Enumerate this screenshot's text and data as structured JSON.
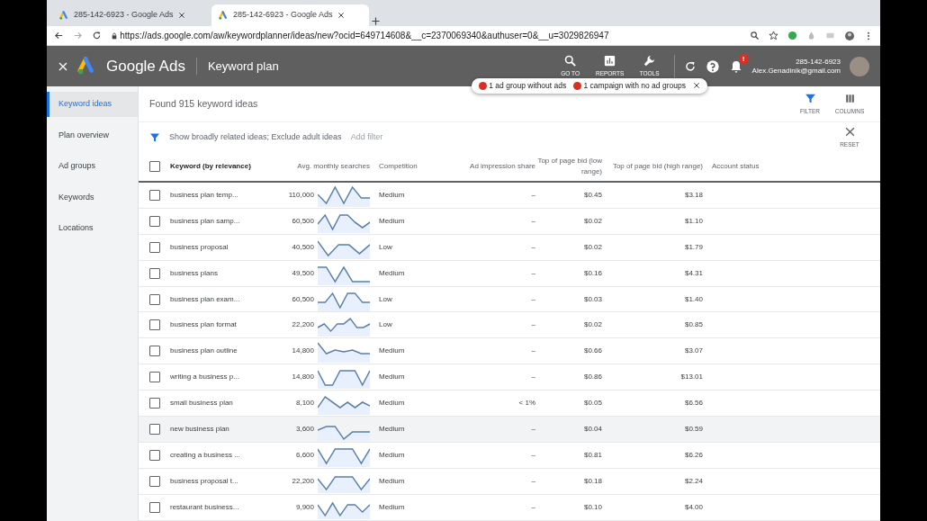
{
  "browser": {
    "tabs": [
      {
        "title": "285-142-6923 - Google Ads",
        "selected": false
      },
      {
        "title": "285-142-6923 - Google Ads",
        "selected": true
      }
    ],
    "url": "https://ads.google.com/aw/keywordplanner/ideas/new?ocid=649714608&__c=2370069340&authuser=0&__u=3029826947"
  },
  "header": {
    "product": "Google Ads",
    "page_title": "Keyword plan",
    "tools": [
      {
        "label": "GO TO"
      },
      {
        "label": "REPORTS"
      },
      {
        "label": "TOOLS"
      }
    ],
    "account_id": "285-142-6923",
    "email": "Alex.Genadinik@gmail.com",
    "notification_badge": "!"
  },
  "alerts": [
    "1 ad group without ads",
    "1 campaign with no ad groups"
  ],
  "sidebar": {
    "items": [
      {
        "label": "Keyword ideas",
        "selected": true
      },
      {
        "label": "Plan overview",
        "selected": false
      },
      {
        "label": "Ad groups",
        "selected": false
      },
      {
        "label": "Keywords",
        "selected": false
      },
      {
        "label": "Locations",
        "selected": false
      }
    ]
  },
  "summary": "Found 915 keyword ideas",
  "toolbar": [
    {
      "label": "FILTER"
    },
    {
      "label": "COLUMNS"
    }
  ],
  "filter_bar": {
    "filters": "Show broadly related ideas; Exclude adult ideas",
    "add_filter": "Add filter",
    "reset": "RESET"
  },
  "table": {
    "select_all_checked": false,
    "columns": [
      "Keyword (by relevance)",
      "Avg. monthly searches",
      "Competition",
      "Ad impression share",
      "Top of page bid (low range)",
      "Top of page bid (high range)",
      "Account status"
    ],
    "rows": [
      {
        "keyword": "business plan temp...",
        "searches": "110,000",
        "competition": "Medium",
        "impression_share": "–",
        "bid_low": "$0.45",
        "bid_high": "$3.18",
        "checked": false,
        "hovered": false
      },
      {
        "keyword": "business plan samp...",
        "searches": "60,500",
        "competition": "Medium",
        "impression_share": "–",
        "bid_low": "$0.02",
        "bid_high": "$1.10",
        "checked": false,
        "hovered": false
      },
      {
        "keyword": "business proposal",
        "searches": "40,500",
        "competition": "Low",
        "impression_share": "–",
        "bid_low": "$0.02",
        "bid_high": "$1.79",
        "checked": false,
        "hovered": false
      },
      {
        "keyword": "business plans",
        "searches": "49,500",
        "competition": "Medium",
        "impression_share": "–",
        "bid_low": "$0.16",
        "bid_high": "$4.31",
        "checked": false,
        "hovered": false
      },
      {
        "keyword": "business plan exam...",
        "searches": "60,500",
        "competition": "Low",
        "impression_share": "–",
        "bid_low": "$0.03",
        "bid_high": "$1.40",
        "checked": false,
        "hovered": false
      },
      {
        "keyword": "business plan format",
        "searches": "22,200",
        "competition": "Low",
        "impression_share": "–",
        "bid_low": "$0.02",
        "bid_high": "$0.85",
        "checked": false,
        "hovered": false
      },
      {
        "keyword": "business plan outline",
        "searches": "14,800",
        "competition": "Medium",
        "impression_share": "–",
        "bid_low": "$0.66",
        "bid_high": "$3.07",
        "checked": false,
        "hovered": false
      },
      {
        "keyword": "writing a business p...",
        "searches": "14,800",
        "competition": "Medium",
        "impression_share": "–",
        "bid_low": "$0.86",
        "bid_high": "$13.01",
        "checked": false,
        "hovered": false
      },
      {
        "keyword": "small business plan",
        "searches": "8,100",
        "competition": "Medium",
        "impression_share": "< 1%",
        "bid_low": "$0.05",
        "bid_high": "$6.56",
        "checked": false,
        "hovered": false
      },
      {
        "keyword": "new business plan",
        "searches": "3,600",
        "competition": "Medium",
        "impression_share": "–",
        "bid_low": "$0.04",
        "bid_high": "$0.59",
        "checked": false,
        "hovered": true
      },
      {
        "keyword": "creating a business ...",
        "searches": "6,600",
        "competition": "Medium",
        "impression_share": "–",
        "bid_low": "$0.81",
        "bid_high": "$6.26",
        "checked": false,
        "hovered": false
      },
      {
        "keyword": "business proposal t...",
        "searches": "22,200",
        "competition": "Medium",
        "impression_share": "–",
        "bid_low": "$0.18",
        "bid_high": "$2.24",
        "checked": false,
        "hovered": false
      },
      {
        "keyword": "restaurant business...",
        "searches": "9,900",
        "competition": "Medium",
        "impression_share": "–",
        "bid_low": "$0.10",
        "bid_high": "$4.00",
        "checked": false,
        "hovered": false
      }
    ]
  }
}
